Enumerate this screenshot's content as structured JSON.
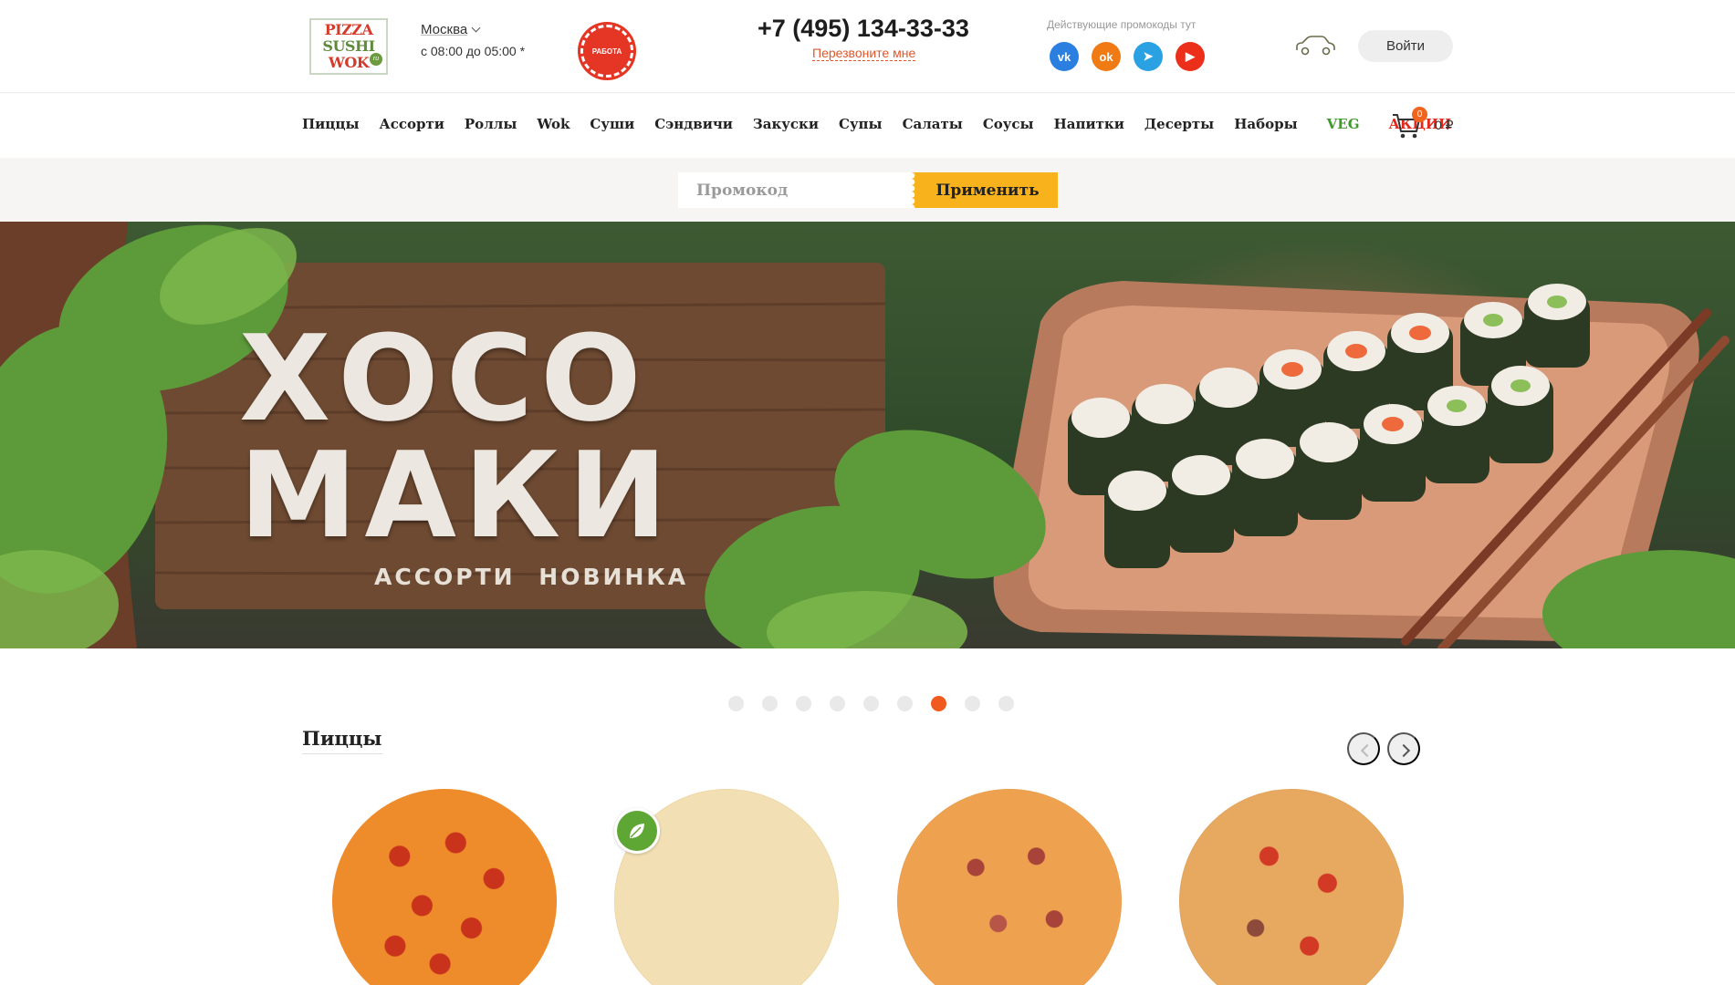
{
  "header": {
    "logo": {
      "line1": "PIZZA",
      "line2": "SUSHI",
      "line3": "WOK",
      "suffix": "ru"
    },
    "city": "Москва",
    "hours": "с 08:00 до 05:00 *",
    "work_badge": "РАБОТА",
    "phone": "+7 (495) 134-33-33",
    "callback": "Перезвоните мне",
    "promo_hint": "Действующие промокоды тут",
    "socials": [
      {
        "name": "vk",
        "glyph": "vk"
      },
      {
        "name": "ok",
        "glyph": "ok"
      },
      {
        "name": "telegram",
        "glyph": "➤"
      },
      {
        "name": "youtube",
        "glyph": "▶"
      }
    ],
    "login": "Войти"
  },
  "nav": {
    "items": [
      "Пиццы",
      "Ассорти",
      "Роллы",
      "Wok",
      "Суши",
      "Сэндвичи",
      "Закуски",
      "Супы",
      "Салаты",
      "Соусы",
      "Напитки",
      "Десерты",
      "Наборы"
    ],
    "veg": "VEG",
    "sale": "АКЦИИ",
    "cart_count": "0",
    "cart_sum": "0 ₽"
  },
  "promo": {
    "placeholder": "Промокод",
    "apply": "Применить"
  },
  "hero": {
    "title_line1": "ХОСО",
    "title_line2": "МАКИ",
    "subtitle": "АССОРТИ НОВИНКА"
  },
  "slider": {
    "total": 9,
    "active": 7
  },
  "section": {
    "title": "Пиццы"
  },
  "colors": {
    "accent": "#f05a1e",
    "promo_button": "#f7b21c",
    "veg": "#3e9a2a",
    "sale": "#e2271c"
  }
}
